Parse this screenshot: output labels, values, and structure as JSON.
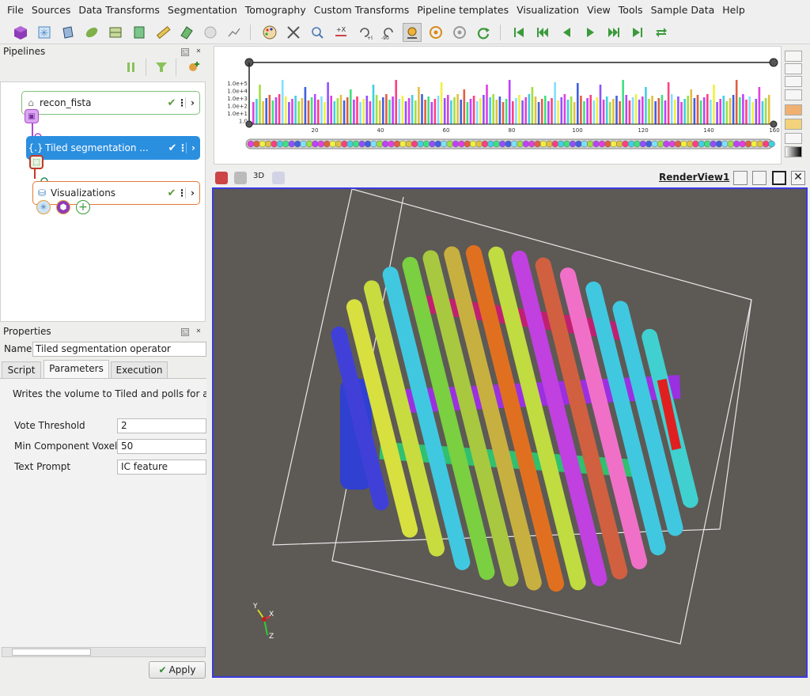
{
  "menu": [
    "File",
    "Sources",
    "Data Transforms",
    "Segmentation",
    "Tomography",
    "Custom Transforms",
    "Pipeline templates",
    "Visualization",
    "View",
    "Tools",
    "Sample Data",
    "Help"
  ],
  "pipelines": {
    "title": "Pipelines",
    "nodes": [
      {
        "label": "recon_fista"
      },
      {
        "label": "Tiled segmentation ..."
      },
      {
        "label": "Visualizations"
      }
    ]
  },
  "properties": {
    "title": "Properties",
    "name_label": "Name",
    "name_value": "Tiled segmentation operator",
    "tabs": [
      "Script",
      "Parameters",
      "Execution"
    ],
    "active_tab": "Parameters",
    "description": "Writes the volume to Tiled and polls for a seg",
    "params": [
      {
        "label": "Vote Threshold",
        "value": "2"
      },
      {
        "label": "Min Component Voxels",
        "value": "50"
      },
      {
        "label": "Text Prompt",
        "value": "IC feature"
      }
    ],
    "apply_label": "Apply"
  },
  "histogram": {
    "y_ticks": [
      "1.0e+5",
      "1.0e+4",
      "1.0e+3",
      "1.0e+2",
      "1.0e+1",
      "1.0"
    ],
    "x_ticks": [
      "20",
      "40",
      "60",
      "80",
      "100",
      "120",
      "140",
      "160"
    ],
    "y_scale": "log"
  },
  "render_view": {
    "title": "RenderView1",
    "mode_label": "3D",
    "axes": {
      "y": "Y",
      "x": "X",
      "z": "Z"
    }
  },
  "colors": {
    "selected_node": "#2b8fe0",
    "render_bg": "#5d5955",
    "render_border": "#3a3ae0"
  }
}
